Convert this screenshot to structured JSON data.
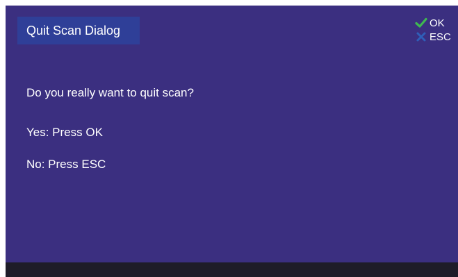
{
  "dialog": {
    "title": "Quit Scan Dialog",
    "question": "Do you really want to quit scan?",
    "yes_instruction": "Yes: Press OK",
    "no_instruction": "No: Press ESC"
  },
  "keys": [
    {
      "icon": "check-icon",
      "label": "OK",
      "color": "#3fb950"
    },
    {
      "icon": "close-icon",
      "label": "ESC",
      "color": "#2f5fb8"
    }
  ],
  "colors": {
    "background": "#3b2f80",
    "title_box": "#2f3f98",
    "footer": "#1e1c28",
    "text": "#ffffff"
  }
}
